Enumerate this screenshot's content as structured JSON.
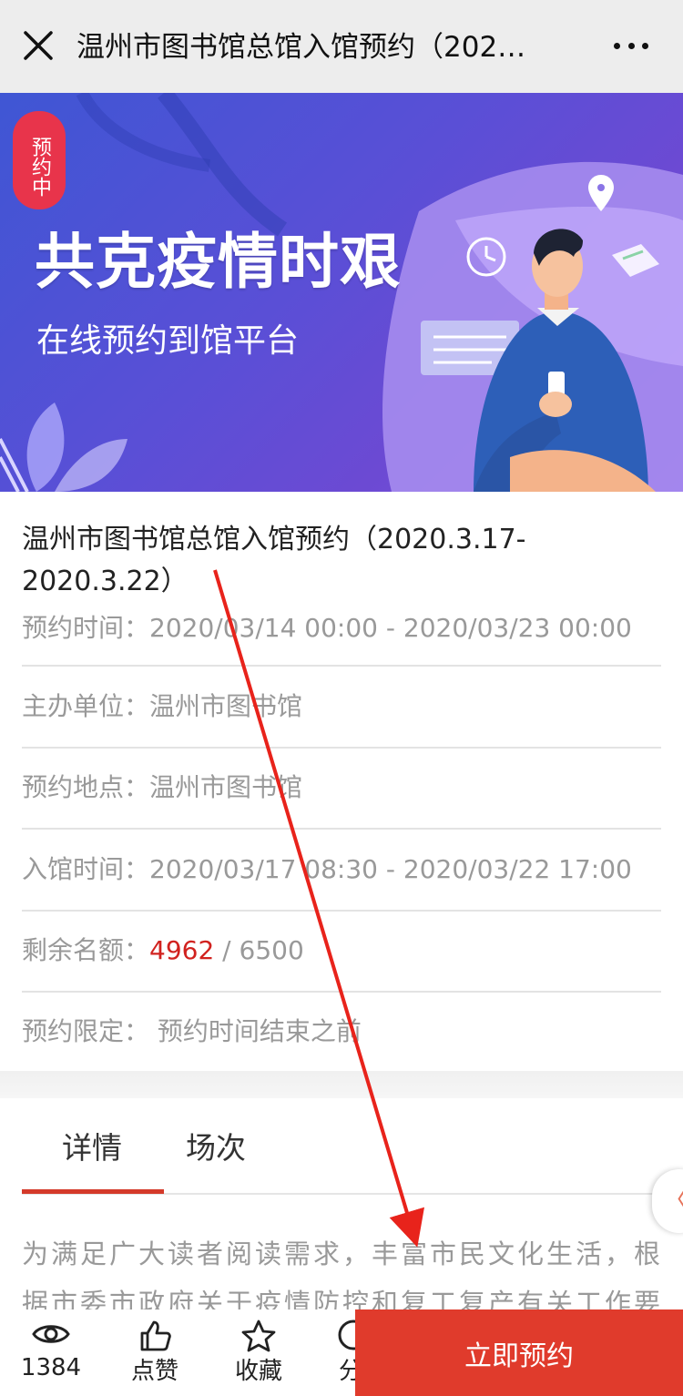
{
  "topbar": {
    "title": "温州市图书馆总馆入馆预约（202…"
  },
  "banner": {
    "status_tag": "预约中",
    "headline": "共克疫情时艰",
    "subline": "在线预约到馆平台"
  },
  "event": {
    "title": "温州市图书馆总馆入馆预约（2020.3.17-2020.3.22）",
    "rows": [
      {
        "label": "预约时间：",
        "value": "2020/03/14 00:00 - 2020/03/23 00:00"
      },
      {
        "label": "主办单位：",
        "value": "温州市图书馆"
      },
      {
        "label": "预约地点：",
        "value": "温州市图书馆"
      },
      {
        "label": "入馆时间：",
        "value": "2020/03/17 08:30 - 2020/03/22 17:00"
      },
      {
        "label": "剩余名额：",
        "remaining": "4962",
        "total": " / 6500"
      },
      {
        "label": "预约限定：",
        "value": " 预约时间结束之前"
      }
    ]
  },
  "tabs": [
    {
      "label": "详情"
    },
    {
      "label": "场次"
    }
  ],
  "side_handle": "〈",
  "description": "为满足广大读者阅读需求，丰富市民文化生活，根据市委市政府关于疫情防控和复工复产有关工作要",
  "bottom": {
    "views": "1384",
    "like": "点赞",
    "favorite": "收藏",
    "share": "分",
    "reserve_button": "立即预约"
  },
  "colors": {
    "accent_red": "#e03b2c",
    "remaining_red": "#d1221f",
    "banner_purple": "#5a4fd6"
  }
}
